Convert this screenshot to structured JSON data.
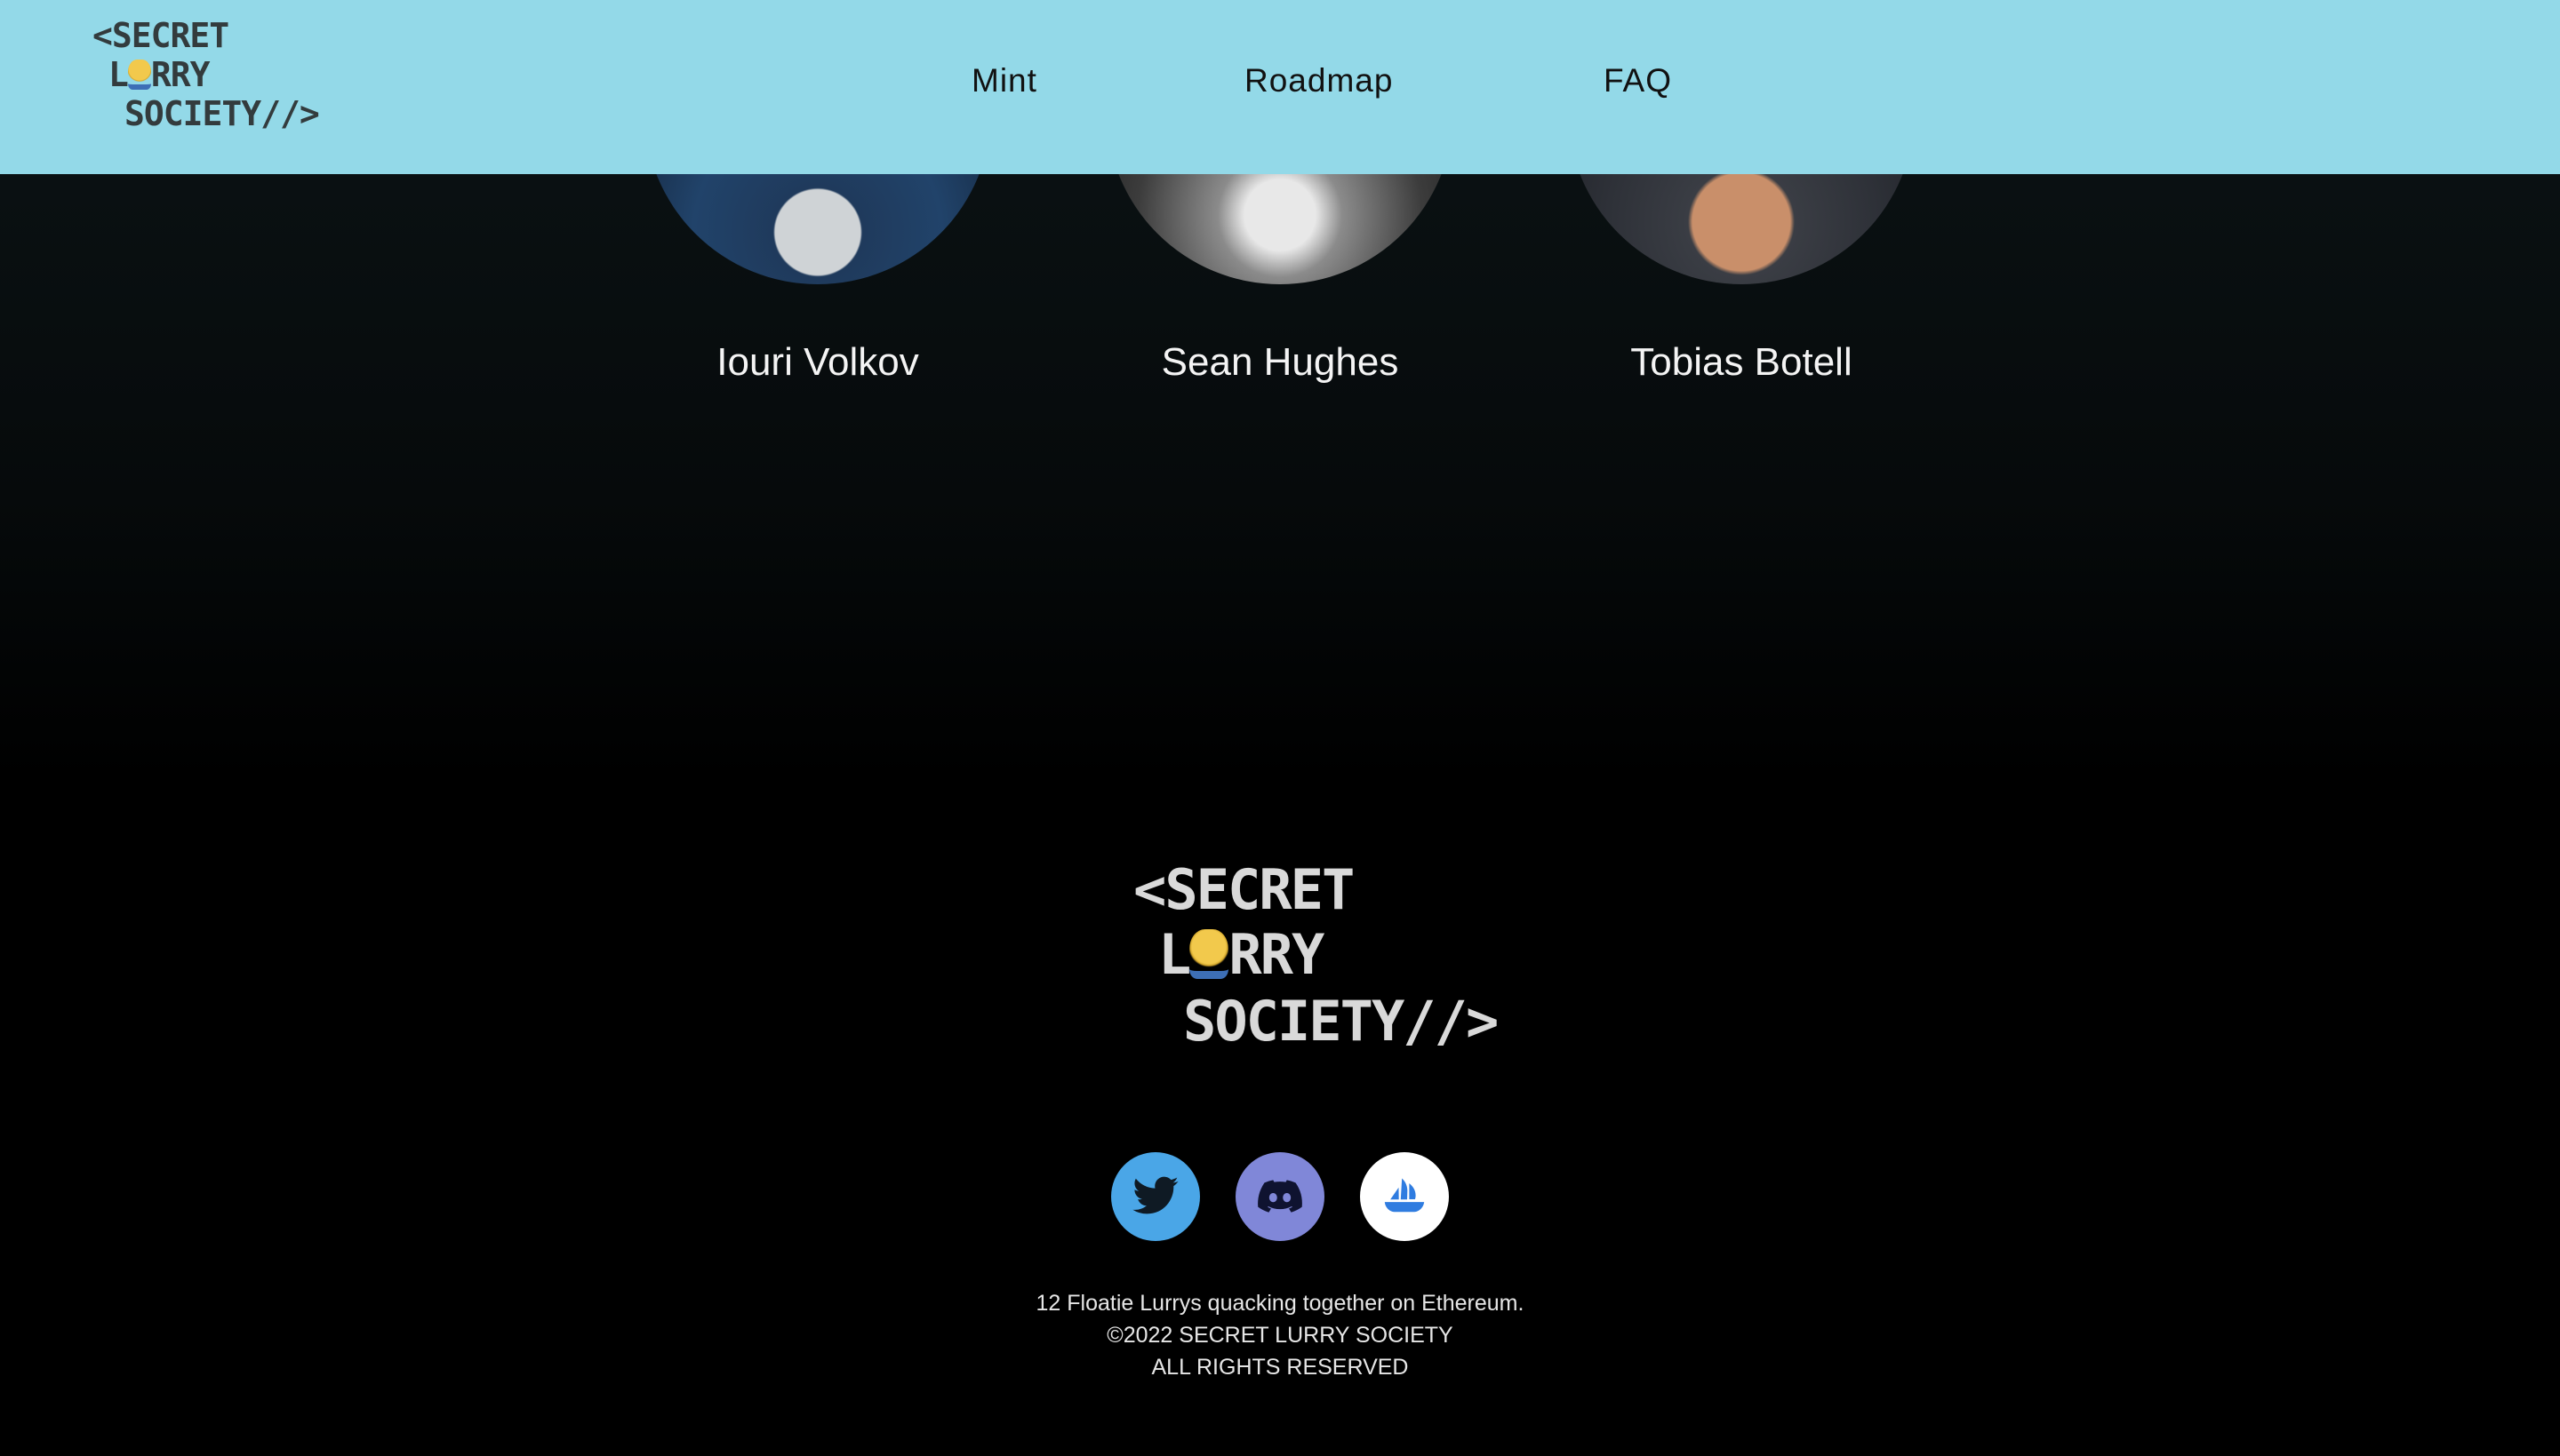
{
  "header": {
    "logo": {
      "line1": "<SECRET",
      "line2a": "L",
      "line2b": "RRY",
      "line3": "SOCIETY//>"
    },
    "nav": [
      {
        "label": "Mint"
      },
      {
        "label": "Roadmap"
      },
      {
        "label": "FAQ"
      }
    ],
    "background": "#93d9e8"
  },
  "team": {
    "members": [
      {
        "name": "Iouri Volkov"
      },
      {
        "name": "Sean Hughes"
      },
      {
        "name": "Tobias Botell"
      }
    ]
  },
  "footer": {
    "logo": {
      "line1": "<SECRET",
      "line2a": "L",
      "line2b": "RRY",
      "line3": "SOCIETY//>"
    },
    "social": [
      {
        "icon": "twitter-icon",
        "color": "#4aa6e7"
      },
      {
        "icon": "discord-icon",
        "color": "#8087d8"
      },
      {
        "icon": "opensea-icon",
        "color": "#ffffff"
      }
    ],
    "tagline": "12 Floatie Lurrys quacking together on Ethereum.",
    "copyright": "©2022 SECRET LURRY SOCIETY",
    "rights": "ALL RIGHTS RESERVED"
  }
}
